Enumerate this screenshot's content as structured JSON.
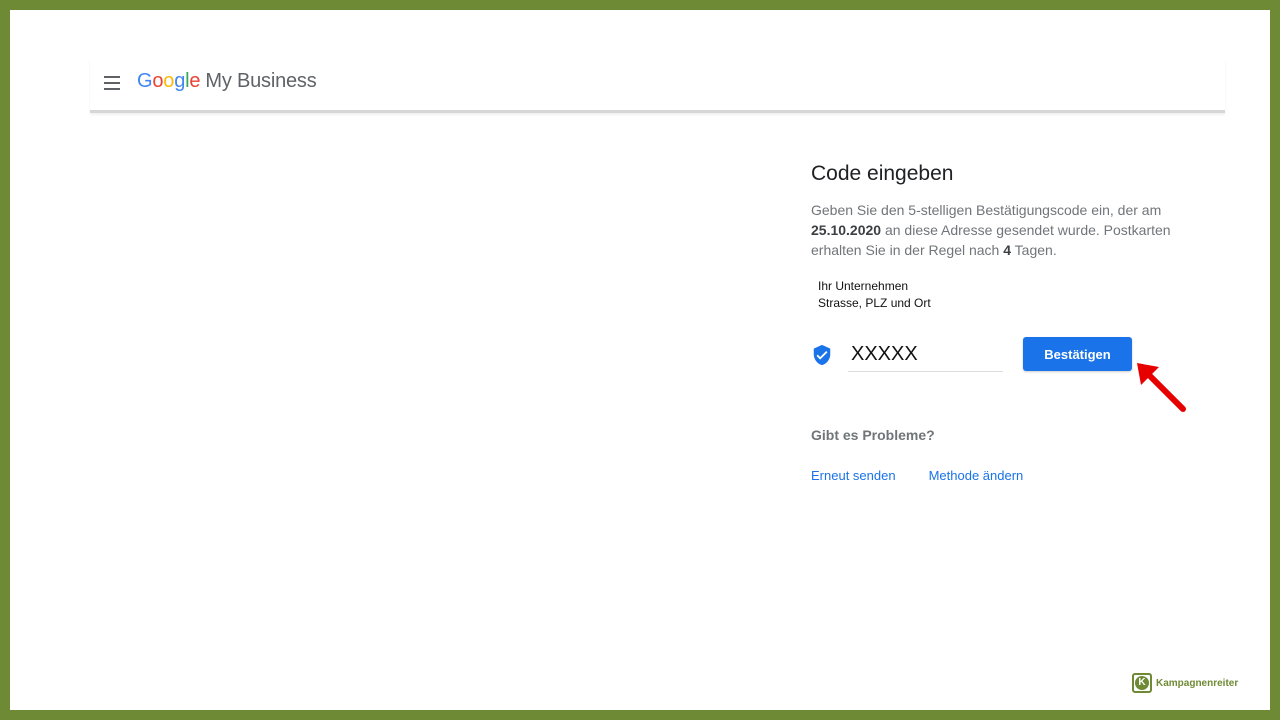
{
  "header": {
    "logo_letters": [
      "G",
      "o",
      "o",
      "g",
      "l",
      "e"
    ],
    "product_name": "My Business"
  },
  "verification": {
    "title": "Code eingeben",
    "description_part1": "Geben Sie den 5-stelligen Bestätigungscode ein, der am ",
    "date": "25.10.2020",
    "description_part2": " an diese Adresse gesendet wurde. Postkarten erhalten Sie in der Regel nach ",
    "days": "4",
    "description_part3": " Tagen.",
    "address_line1": "Ihr Unternehmen",
    "address_line2": "Strasse, PLZ und Ort",
    "code_value": "XXXXX",
    "confirm_label": "Bestätigen",
    "problems_label": "Gibt es Probleme?",
    "resend_label": "Erneut senden",
    "change_method_label": "Methode ändern"
  },
  "watermark": {
    "logo_letter": "K",
    "brand": "Kampagnenreiter"
  },
  "colors": {
    "border_green": "#6f8a34",
    "accent_blue": "#1a73e8",
    "arrow_red": "#e60000"
  },
  "icons": {
    "menu": "hamburger-menu-icon",
    "shield": "verified-shield-icon",
    "arrow": "red-pointer-arrow-icon"
  }
}
